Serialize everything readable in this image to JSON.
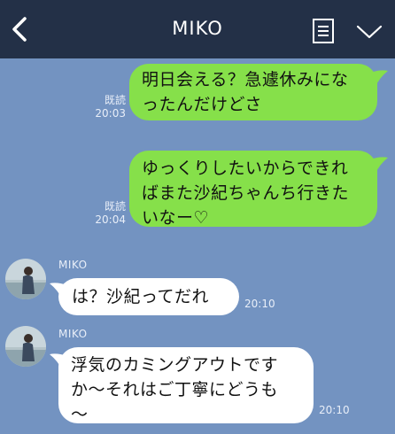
{
  "header": {
    "title": "MIKO",
    "back_icon": "chevron-left-icon",
    "note_icon": "note-list-icon",
    "menu_icon": "chevron-down-icon",
    "bg_color": "#233047"
  },
  "chat": {
    "bg_color": "#7393c1",
    "outgoing_color": "#86e04a",
    "incoming_color": "#ffffff",
    "messages": [
      {
        "direction": "outgoing",
        "lines": [
          "明日会える？急遽休みにな",
          "ったんだけどさ"
        ],
        "read": "既読",
        "time": "20:03"
      },
      {
        "direction": "outgoing",
        "lines": [
          "ゆっくりしたいからできれ",
          "ばまた沙紀ちゃんち行きた",
          "いなー♡"
        ],
        "read": "既読",
        "time": "20:04"
      },
      {
        "direction": "incoming",
        "sender": "MIKO",
        "lines": [
          "は？沙紀ってだれ"
        ],
        "time": "20:10"
      },
      {
        "direction": "incoming",
        "sender": "MIKO",
        "lines": [
          "浮気のカミングアウトです",
          "か〜それはご丁寧にどうも",
          "〜"
        ],
        "time": "20:10"
      }
    ]
  }
}
